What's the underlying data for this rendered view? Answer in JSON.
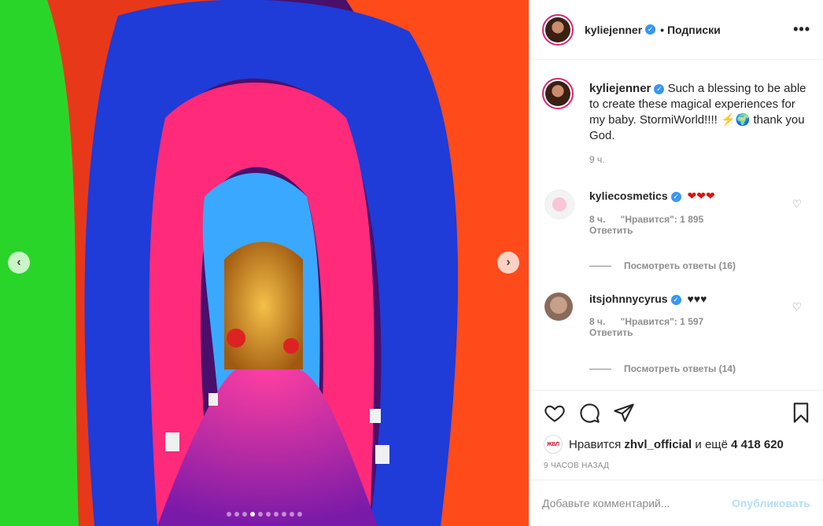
{
  "post": {
    "username": "kyliejenner",
    "follow_label": "• Подписки",
    "more_label": "•••",
    "caption": "Such a blessing to be able to create these magical experiences for my baby. StormiWorld!!!! ⚡🌍 thank you God.",
    "caption_time": "9 ч."
  },
  "comments": [
    {
      "username": "kyliecosmetics",
      "text": "❤❤❤",
      "time": "8 ч.",
      "likes": "\"Нравится\": 1 895",
      "reply_label": "Ответить",
      "view_replies": "Посмотреть ответы (16)"
    },
    {
      "username": "itsjohnnycyrus",
      "text": "♥♥♥",
      "time": "8 ч.",
      "likes": "\"Нравится\": 1 597",
      "reply_label": "Ответить",
      "view_replies": "Посмотреть ответы (14)"
    }
  ],
  "likes_line": {
    "prefix": "Нравится",
    "liker": "zhvl_official",
    "middle": "и ещё",
    "count": "4 418 620",
    "liker_badge": "ЖВЛ"
  },
  "posted_time": "9 ЧАСОВ НАЗАД",
  "add_comment": {
    "placeholder": "Добавьте комментарий...",
    "publish_label": "Опубликовать"
  },
  "carousel": {
    "total": 10,
    "active_index": 3,
    "prev_label": "‹",
    "next_label": "›"
  },
  "colors": {
    "verified": "#3897f0",
    "publish": "#b2dffc",
    "muted": "#8e8e8e"
  }
}
